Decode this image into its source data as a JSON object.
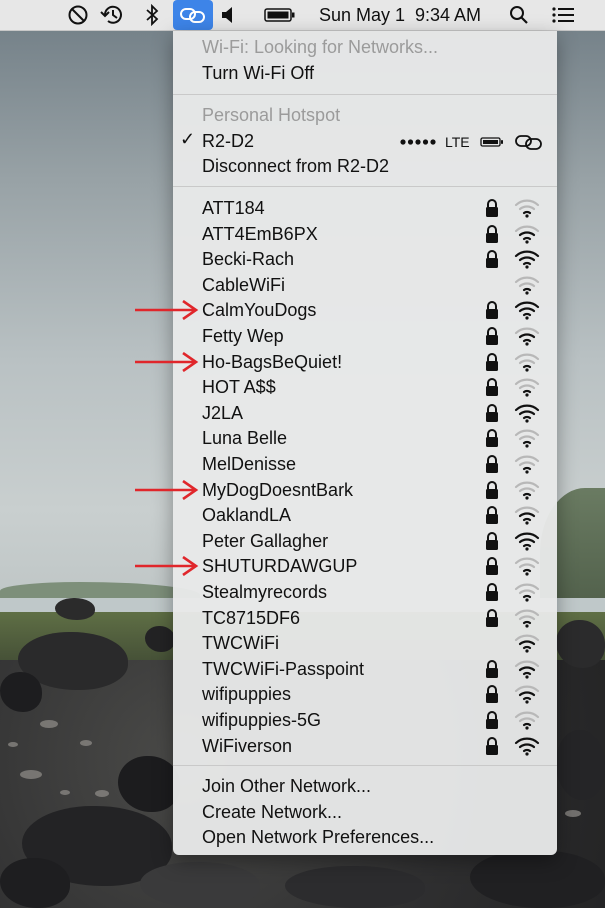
{
  "menubar": {
    "datetime": "Sun May 1  9:34 AM"
  },
  "wifi_menu": {
    "status": "Wi-Fi: Looking for Networks...",
    "toggle": "Turn Wi-Fi Off",
    "hotspot_header": "Personal Hotspot",
    "hotspot_name": "R2-D2",
    "hotspot_network_type": "LTE",
    "disconnect": "Disconnect from R2-D2",
    "networks": [
      {
        "name": "ATT184",
        "secured": true,
        "signal": 1
      },
      {
        "name": "ATT4EmB6PX",
        "secured": true,
        "signal": 2
      },
      {
        "name": "Becki-Rach",
        "secured": true,
        "signal": 3
      },
      {
        "name": "CableWiFi",
        "secured": false,
        "signal": 1
      },
      {
        "name": "CalmYouDogs",
        "secured": true,
        "signal": 3,
        "highlighted": true
      },
      {
        "name": "Fetty Wep",
        "secured": true,
        "signal": 2
      },
      {
        "name": "Ho-BagsBeQuiet!",
        "secured": true,
        "signal": 1,
        "highlighted": true
      },
      {
        "name": "HOT A$$",
        "secured": true,
        "signal": 1
      },
      {
        "name": "J2LA",
        "secured": true,
        "signal": 3
      },
      {
        "name": "Luna Belle",
        "secured": true,
        "signal": 1
      },
      {
        "name": "MelDenisse",
        "secured": true,
        "signal": 1
      },
      {
        "name": "MyDogDoesntBark",
        "secured": true,
        "signal": 1,
        "highlighted": true
      },
      {
        "name": "OaklandLA",
        "secured": true,
        "signal": 2
      },
      {
        "name": "Peter Gallagher",
        "secured": true,
        "signal": 3
      },
      {
        "name": "SHUTURDAWGUP",
        "secured": true,
        "signal": 1,
        "highlighted": true
      },
      {
        "name": "Stealmyrecords",
        "secured": true,
        "signal": 1
      },
      {
        "name": "TC8715DF6",
        "secured": true,
        "signal": 1
      },
      {
        "name": "TWCWiFi",
        "secured": false,
        "signal": 2
      },
      {
        "name": "TWCWiFi-Passpoint",
        "secured": true,
        "signal": 2
      },
      {
        "name": "wifipuppies",
        "secured": true,
        "signal": 2
      },
      {
        "name": "wifipuppies-5G",
        "secured": true,
        "signal": 1
      },
      {
        "name": "WiFiverson",
        "secured": true,
        "signal": 3
      }
    ],
    "join_other": "Join Other Network...",
    "create": "Create Network...",
    "preferences": "Open Network Preferences..."
  },
  "icons": {
    "menubar": [
      "do-not-disturb-icon",
      "time-machine-icon",
      "bluetooth-icon",
      "hotspot-icon",
      "volume-icon",
      "battery-icon",
      "search-icon",
      "notification-list-icon"
    ]
  },
  "colors": {
    "menu_highlight": "#3d84e8",
    "annotation_arrow": "#e0262b"
  }
}
